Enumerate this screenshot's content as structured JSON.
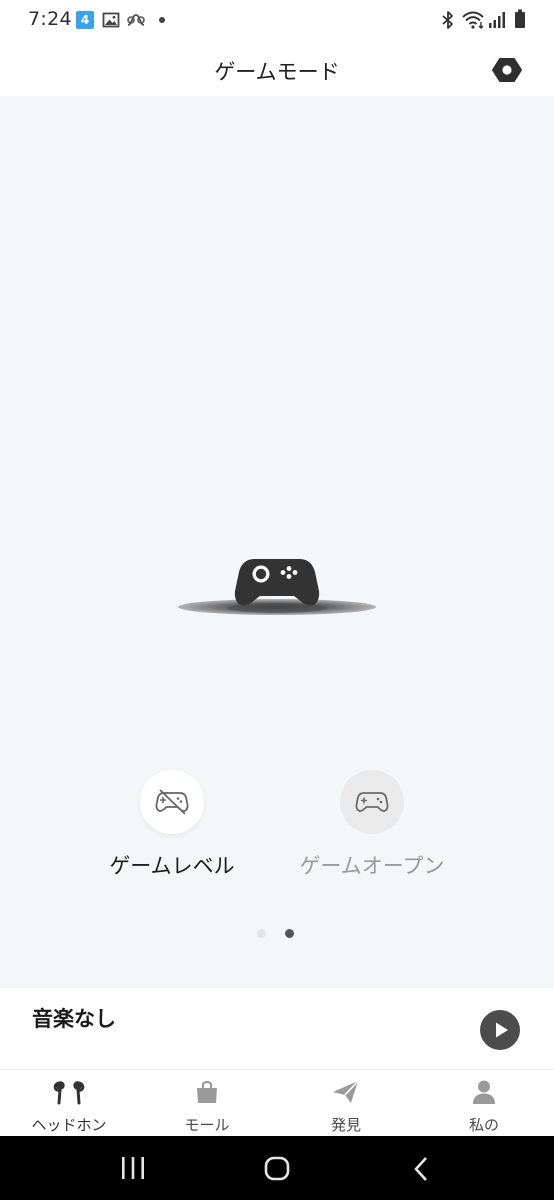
{
  "status_bar": {
    "time": "7:24",
    "app_icon_glyph": "4",
    "icons": [
      "app-notification-icon",
      "gallery-icon",
      "nfc-icon",
      "more-dot-icon",
      "bluetooth-icon",
      "wifi-icon",
      "signal-icon",
      "battery-icon"
    ]
  },
  "header": {
    "title": "ゲームモード",
    "settings_icon": "settings-hex-icon"
  },
  "main": {
    "hero_icon": "game-controller-icon",
    "modes": [
      {
        "label": "ゲームレベル",
        "icon": "controller-off-icon",
        "selected": true
      },
      {
        "label": "ゲームオープン",
        "icon": "controller-icon",
        "selected": false
      }
    ],
    "pager": {
      "count": 2,
      "active": 2
    }
  },
  "player": {
    "title": "音楽なし",
    "play_icon": "play-icon"
  },
  "tabs": [
    {
      "label": "ヘッドホン",
      "icon": "earbuds-icon"
    },
    {
      "label": "モール",
      "icon": "shopping-bag-icon"
    },
    {
      "label": "発見",
      "icon": "paper-plane-icon"
    },
    {
      "label": "私の",
      "icon": "person-icon"
    }
  ],
  "system_nav": [
    "recents-icon",
    "home-icon",
    "back-icon"
  ],
  "colors": {
    "main_background": "#f5f6f8",
    "dark_icon": "#3a3a3a",
    "inactive_text": "#9a9a9a",
    "nav_bar": "#000000"
  }
}
